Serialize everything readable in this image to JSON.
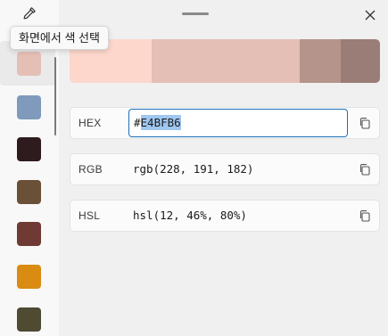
{
  "tooltip": {
    "text": "화면에서 색 선택"
  },
  "swatches": [
    {
      "color": "#e4bfb6"
    },
    {
      "color": "#7f9abb"
    },
    {
      "color": "#2e1b1e"
    },
    {
      "color": "#6b5038"
    },
    {
      "color": "#6f3a34"
    },
    {
      "color": "#d98b12"
    },
    {
      "color": "#4f4a32"
    }
  ],
  "palette": {
    "shades": [
      "#fdd7cb",
      "#e4bfb6",
      "#e4bfb6",
      "#b4948b",
      "#9a7d76"
    ]
  },
  "formats": {
    "hex": {
      "label": "HEX",
      "prefix": "#",
      "value": "E4BFB6"
    },
    "rgb": {
      "label": "RGB",
      "value": "rgb(228, 191, 182)"
    },
    "hsl": {
      "label": "HSL",
      "value": "hsl(12, 46%, 80%)"
    }
  }
}
